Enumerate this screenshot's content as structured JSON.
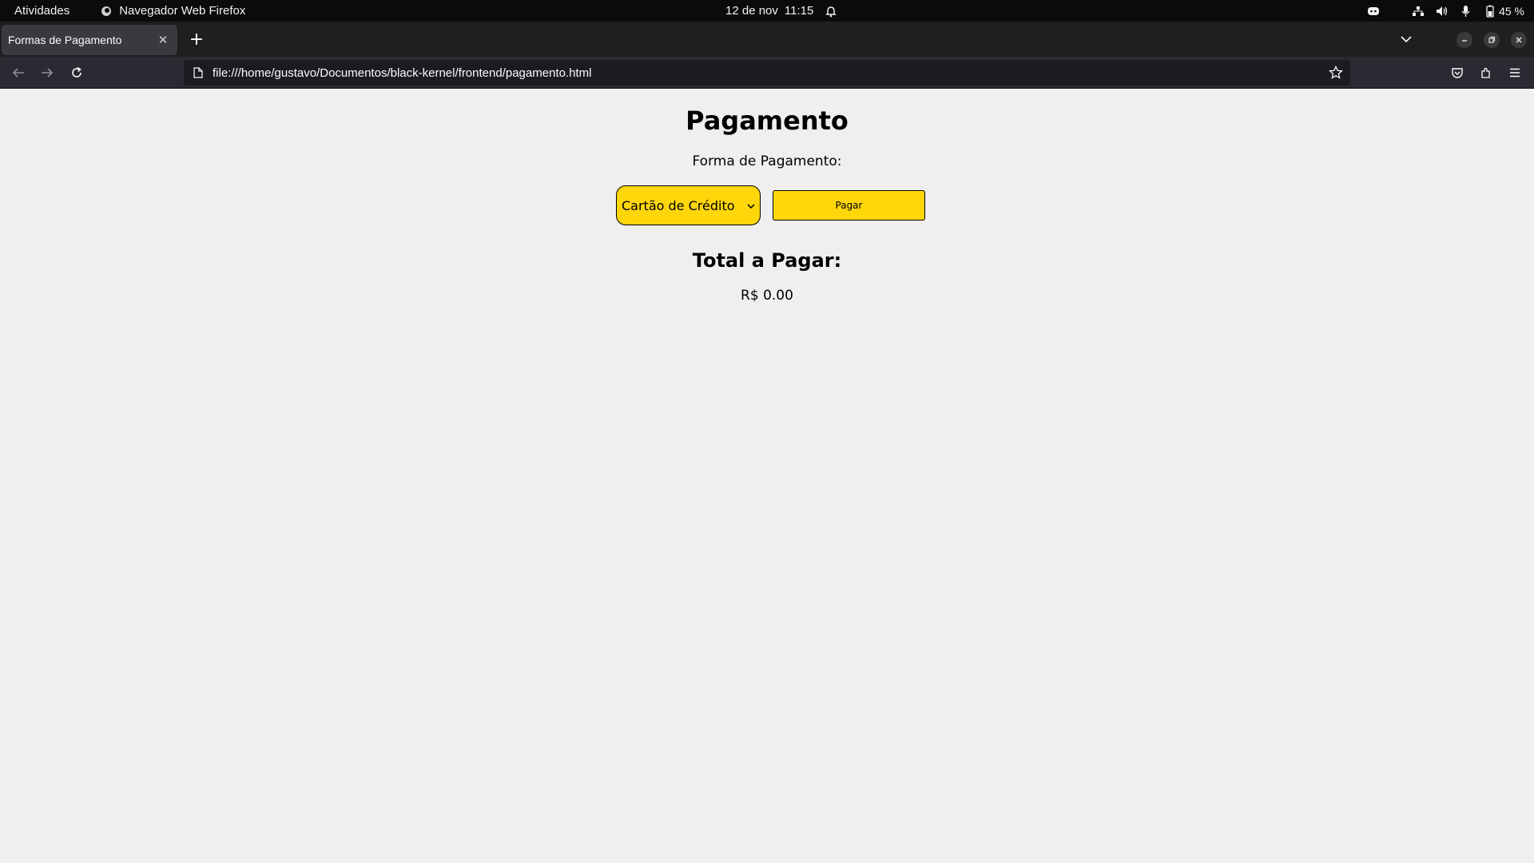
{
  "system_bar": {
    "activities": "Atividades",
    "app_name": "Navegador Web Firefox",
    "date": "12 de nov",
    "time": "11:15",
    "battery": "45 %"
  },
  "browser": {
    "tab_title": "Formas de Pagamento",
    "url": "file:///home/gustavo/Documentos/black-kernel/frontend/pagamento.html"
  },
  "page": {
    "title": "Pagamento",
    "payment_label": "Forma de Pagamento:",
    "payment_selected": "Cartão de Crédito",
    "pay_button": "Pagar",
    "total_title": "Total a Pagar:",
    "total_value": "R$ 0.00"
  },
  "colors": {
    "accent_yellow": "#ffd60a",
    "page_background": "#efefef",
    "browser_chrome": "#2b2a33"
  }
}
